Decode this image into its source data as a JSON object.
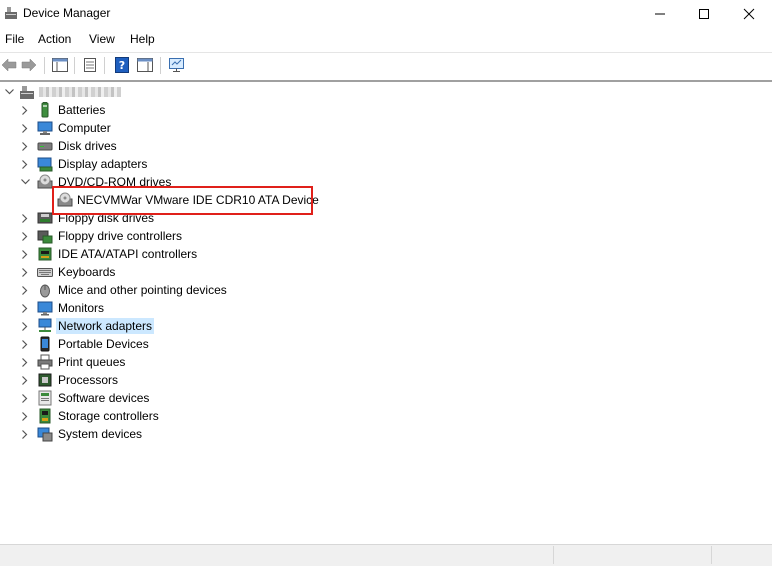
{
  "window": {
    "title": "Device Manager"
  },
  "menu": {
    "items": [
      "File",
      "Action",
      "View",
      "Help"
    ]
  },
  "tree": {
    "categories": [
      {
        "label": "Batteries",
        "icon": "battery-icon",
        "expanded": false
      },
      {
        "label": "Computer",
        "icon": "computer-icon",
        "expanded": false
      },
      {
        "label": "Disk drives",
        "icon": "disk-drive-icon",
        "expanded": false
      },
      {
        "label": "Display adapters",
        "icon": "display-adapter-icon",
        "expanded": false
      },
      {
        "label": "DVD/CD-ROM drives",
        "icon": "dvd-drive-icon",
        "expanded": true,
        "children": [
          {
            "label": "NECVMWar VMware IDE CDR10 ATA Device",
            "icon": "cdrom-device-icon"
          }
        ]
      },
      {
        "label": "Floppy disk drives",
        "icon": "floppy-disk-icon",
        "expanded": false
      },
      {
        "label": "Floppy drive controllers",
        "icon": "floppy-controller-icon",
        "expanded": false
      },
      {
        "label": "IDE ATA/ATAPI controllers",
        "icon": "ide-controller-icon",
        "expanded": false
      },
      {
        "label": "Keyboards",
        "icon": "keyboard-icon",
        "expanded": false
      },
      {
        "label": "Mice and other pointing devices",
        "icon": "mouse-icon",
        "expanded": false
      },
      {
        "label": "Monitors",
        "icon": "monitor-icon",
        "expanded": false
      },
      {
        "label": "Network adapters",
        "icon": "network-adapter-icon",
        "expanded": false,
        "selected": true
      },
      {
        "label": "Portable Devices",
        "icon": "portable-device-icon",
        "expanded": false
      },
      {
        "label": "Print queues",
        "icon": "printer-icon",
        "expanded": false
      },
      {
        "label": "Processors",
        "icon": "processor-icon",
        "expanded": false
      },
      {
        "label": "Software devices",
        "icon": "software-device-icon",
        "expanded": false
      },
      {
        "label": "Storage controllers",
        "icon": "storage-controller-icon",
        "expanded": false
      },
      {
        "label": "System devices",
        "icon": "system-device-icon",
        "expanded": false
      }
    ]
  },
  "colors": {
    "selection": "#cce8ff",
    "highlight_border": "#e0201a",
    "help_icon": "#1f5fbf"
  }
}
